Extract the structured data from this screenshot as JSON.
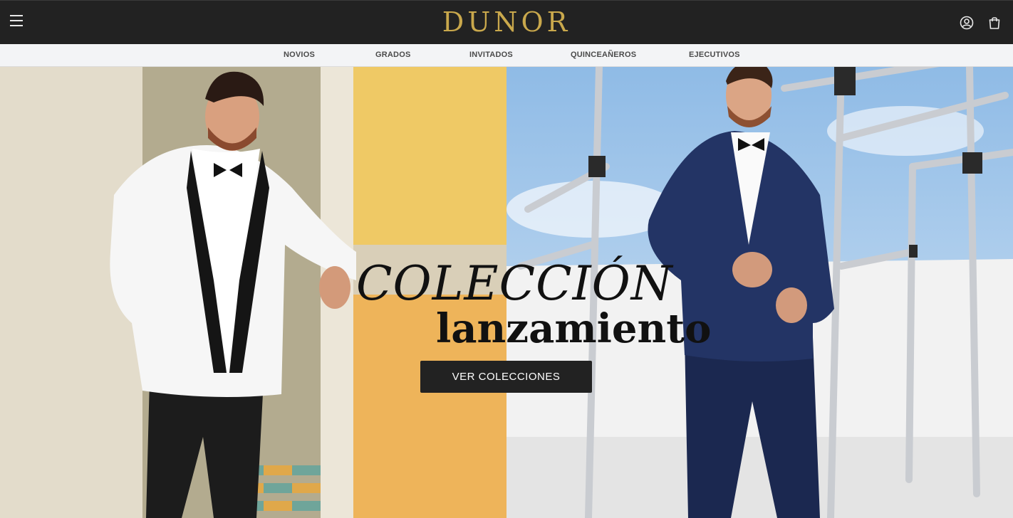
{
  "brand": {
    "logo_text": "DUNOR",
    "logo_color": "#c9a84c"
  },
  "header": {
    "menu_icon": "hamburger-menu-icon",
    "user_icon": "user-account-icon",
    "cart_icon": "shopping-bag-icon"
  },
  "nav": {
    "items": [
      {
        "label": "NOVIOS"
      },
      {
        "label": "GRADOS"
      },
      {
        "label": "INVITADOS"
      },
      {
        "label": "QUINCEAÑEROS"
      },
      {
        "label": "EJECUTIVOS"
      }
    ]
  },
  "hero": {
    "title": "COLECCIÓN",
    "subtitle": "lanzamiento",
    "cta_label": "VER COLECCIONES"
  },
  "colors": {
    "header_bg": "#222222",
    "nav_bg": "#f3f4f6",
    "cta_bg": "#222222",
    "accent_gold": "#c9a84c"
  }
}
